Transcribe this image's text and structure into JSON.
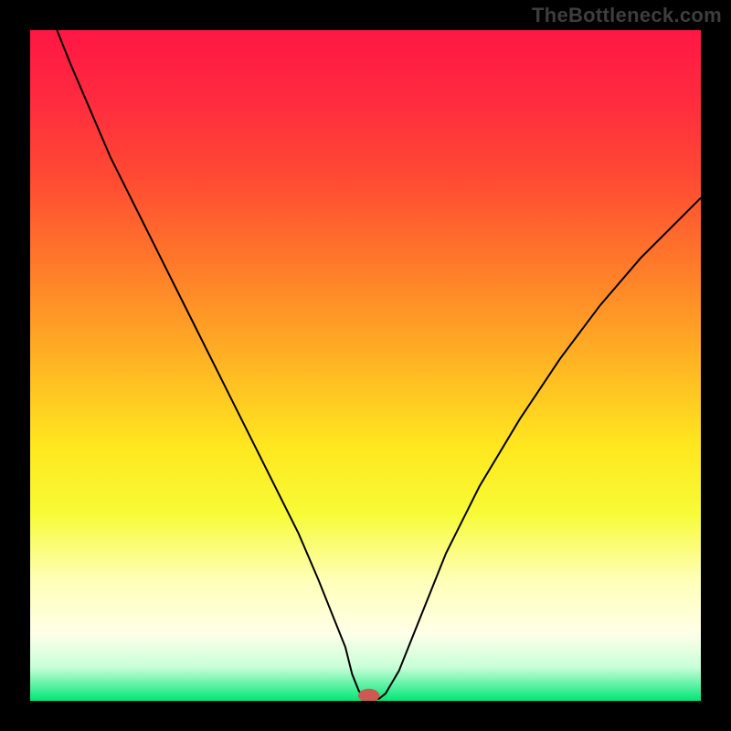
{
  "watermark": "TheBottleneck.com",
  "chart_data": {
    "type": "line",
    "title": "",
    "xlabel": "",
    "ylabel": "",
    "xlim": [
      0,
      100
    ],
    "ylim": [
      0,
      100
    ],
    "background_gradient": {
      "stops": [
        {
          "offset": 0.0,
          "color": "#ff1744"
        },
        {
          "offset": 0.1,
          "color": "#ff2a3f"
        },
        {
          "offset": 0.22,
          "color": "#ff4a33"
        },
        {
          "offset": 0.35,
          "color": "#ff7a2a"
        },
        {
          "offset": 0.48,
          "color": "#ffae24"
        },
        {
          "offset": 0.62,
          "color": "#ffe71f"
        },
        {
          "offset": 0.72,
          "color": "#f7fb36"
        },
        {
          "offset": 0.82,
          "color": "#ffffb8"
        },
        {
          "offset": 0.9,
          "color": "#ffffe8"
        },
        {
          "offset": 0.95,
          "color": "#c8ffd8"
        },
        {
          "offset": 1.0,
          "color": "#00e676"
        }
      ]
    },
    "series": [
      {
        "name": "bottleneck-curve",
        "color": "#000000",
        "x": [
          4,
          6,
          9,
          12,
          16,
          20,
          24,
          28,
          32,
          36,
          40,
          43,
          45,
          47,
          48,
          49,
          49.9,
          51,
          52,
          53,
          55,
          58,
          62,
          67,
          73,
          79,
          85,
          91,
          97,
          100
        ],
        "y": [
          100,
          95,
          88,
          81,
          73,
          65,
          57,
          49,
          41,
          33,
          25,
          18,
          13,
          8,
          4.0,
          1.5,
          0.3,
          0.3,
          0.3,
          1.1,
          4.5,
          12,
          22,
          32,
          42,
          51,
          59,
          66,
          72,
          75
        ]
      }
    ],
    "marker": {
      "name": "optimal-point",
      "x": 50.5,
      "y": 0.8,
      "color": "#cc5a52",
      "rx": 1.6,
      "ry": 1.0
    }
  }
}
